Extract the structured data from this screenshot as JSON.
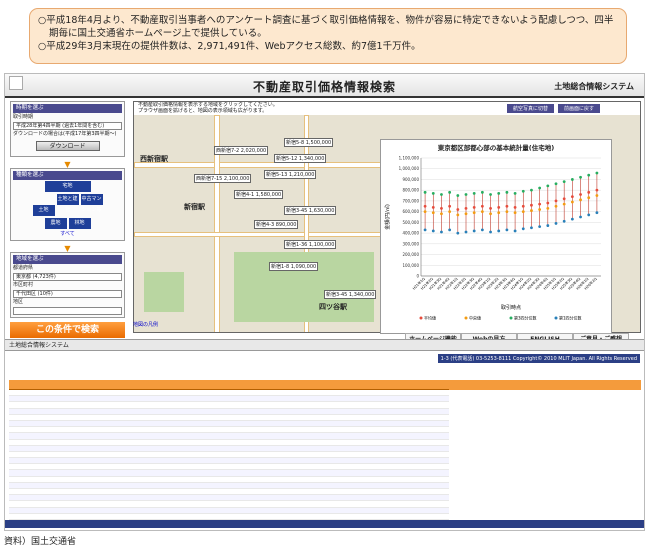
{
  "notes": [
    "○平成18年4月より、不動産取引当事者へのアンケート調査に基づく取引価格情報を、物件が容易に特定できないよう配慮しつつ、四半期毎に国土交通省ホームページ上で提供している。",
    "○平成29年3月末現在の提供件数は、2,971,491件、Webアクセス総数、約7億1千万件。"
  ],
  "header": {
    "title": "不動産取引価格情報検索",
    "system": "土地総合情報システム"
  },
  "sidebar": {
    "s1": "時期を選ぶ",
    "s1_sub": "取引時期",
    "s1_val": "平成28年第4四半期 (過去1年間を含む)",
    "dl_note": "ダウンロードの場合は(平成17年第3四半期～)",
    "download": "ダウンロード",
    "s2": "種類を選ぶ",
    "types": [
      "宅地",
      "土地",
      "土地と建物",
      "中古マンション等",
      "農地",
      "林地"
    ],
    "all": "すべて",
    "s3": "地域を選ぶ",
    "pref_label": "都道府県",
    "pref": "東京都 (4,723件)",
    "city_label": "市区町村",
    "city": "千代田区 (10件)",
    "district_label": "地区",
    "go": "この条件で検索"
  },
  "map": {
    "hint1": "不動産取引価格情報を表示する地域をクリックしてください。",
    "hint2": "プラウザ画面を拡げると、地図の表示領域も広がります。",
    "tabs": [
      "航空写真に切替",
      "前画面に戻す"
    ],
    "labels": [
      "新宿5-8 1,500,000",
      "新宿5-14 1,200,000",
      "西新宿7-2 2,020,000",
      "新宿5-12 1,340,000",
      "西新宿7-15 2,100,000",
      "新宿5-13 1,210,000",
      "歌舞伎町 1,650,000",
      "新宿4-1 1,580,000",
      "新宿3-45 1,630,000",
      "新宿3-45 1,340,000",
      "新宿4-3 890,000",
      "新宿1-36 1,100,000",
      "新宿1-8 1,090,000",
      "新宿3-15 1,200,000"
    ],
    "stations": [
      "新宿駅",
      "西新宿駅",
      "西新宿五丁目",
      "四ツ谷駅",
      "新大久保"
    ],
    "link": "地図の凡例"
  },
  "chart_data": {
    "type": "scatter",
    "title": "東京都区部都心部の基本統計量(住宅地)",
    "ylabel": "金額(円/㎡)",
    "xlabel": "取引時点",
    "ylim": [
      0,
      1100000
    ],
    "yticks": [
      0,
      100000,
      200000,
      300000,
      400000,
      500000,
      600000,
      700000,
      800000,
      900000,
      1000000,
      1100000
    ],
    "x": [
      "H21年1Q",
      "H21年2Q",
      "H21年3Q",
      "H21年4Q",
      "H22年1Q",
      "H22年2Q",
      "H22年3Q",
      "H22年4Q",
      "H23年1Q",
      "H23年2Q",
      "H23年3Q",
      "H23年4Q",
      "H24年1Q",
      "H24年2Q",
      "H24年3Q",
      "H24年4Q",
      "H25年1Q",
      "H25年2Q",
      "H25年3Q",
      "H25年4Q",
      "H26年1Q",
      "H26年2Q"
    ],
    "series": [
      {
        "name": "平均値",
        "color": "#e74c3c",
        "values": [
          650000,
          640000,
          630000,
          650000,
          620000,
          630000,
          640000,
          650000,
          630000,
          640000,
          650000,
          640000,
          650000,
          660000,
          670000,
          680000,
          700000,
          720000,
          740000,
          760000,
          780000,
          800000
        ]
      },
      {
        "name": "中央値",
        "color": "#f39c12",
        "values": [
          600000,
          590000,
          580000,
          600000,
          570000,
          580000,
          590000,
          600000,
          580000,
          590000,
          600000,
          590000,
          600000,
          610000,
          620000,
          630000,
          650000,
          670000,
          690000,
          710000,
          730000,
          750000
        ]
      },
      {
        "name": "第3四分位数",
        "color": "#27ae60",
        "values": [
          780000,
          770000,
          760000,
          780000,
          750000,
          760000,
          770000,
          780000,
          760000,
          770000,
          780000,
          770000,
          790000,
          800000,
          820000,
          840000,
          860000,
          880000,
          900000,
          920000,
          940000,
          960000
        ]
      },
      {
        "name": "第1四分位数",
        "color": "#2980b9",
        "values": [
          430000,
          420000,
          410000,
          430000,
          400000,
          410000,
          420000,
          430000,
          410000,
          420000,
          430000,
          420000,
          440000,
          450000,
          460000,
          470000,
          490000,
          510000,
          530000,
          550000,
          570000,
          590000
        ]
      }
    ],
    "legend": "bottom"
  },
  "bottom_tabs": [
    "ホームページ機能",
    "Webの見方",
    "ENGLISH",
    "ご意見・ご感想"
  ],
  "table_shot": {
    "title": "土地総合情報システム",
    "copyright": "1-3 (代表電話) 03-5253-8111 Copyright© 2010 MLIT Japan. All Rights Reserved"
  },
  "source": "資料）国土交通省"
}
